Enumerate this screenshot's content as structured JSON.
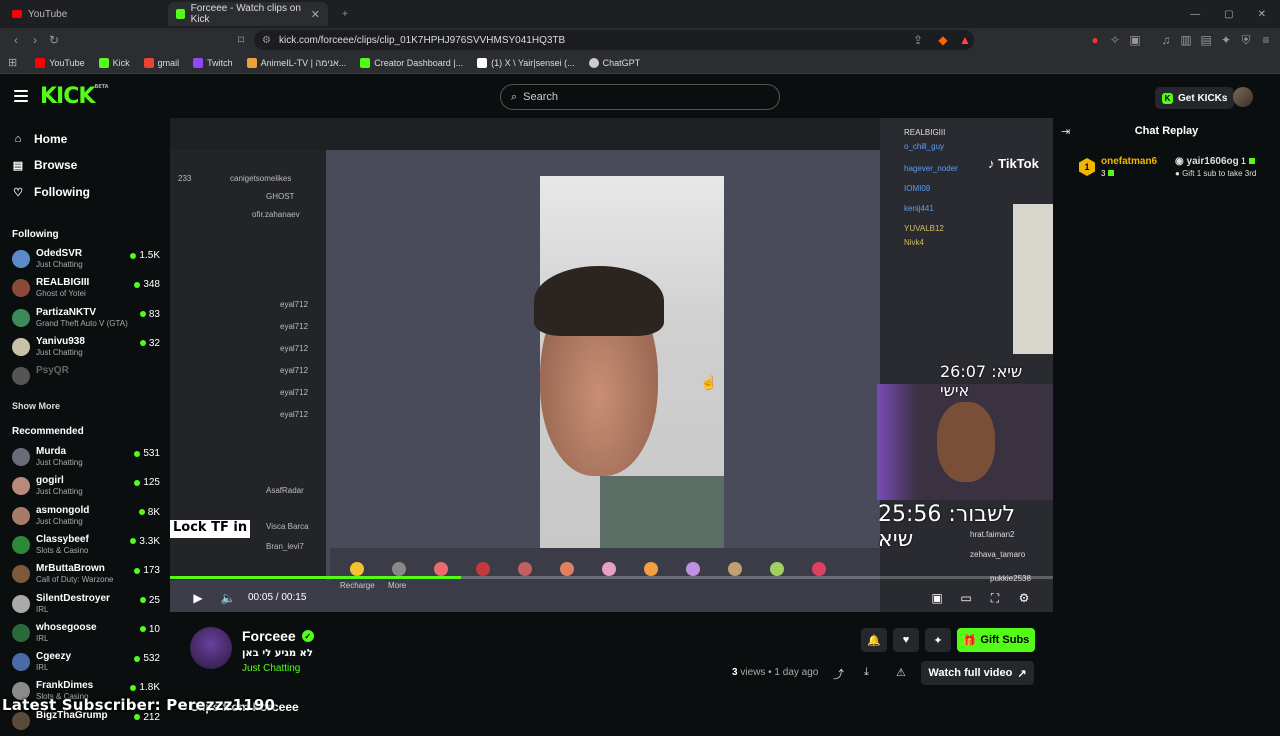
{
  "browser": {
    "tabs": [
      {
        "title": "YouTube"
      },
      {
        "title": "Forceee - Watch clips on Kick"
      }
    ],
    "url": "kick.com/forceee/clips/clip_01K7HPHJ976SVVHMSY041HQ3TB",
    "bookmarks": [
      {
        "label": "YouTube",
        "color": "#ff0000"
      },
      {
        "label": "Kick",
        "color": "#53fc18"
      },
      {
        "label": "gmail",
        "color": "#ea4335"
      },
      {
        "label": "Twitch",
        "color": "#9146ff"
      },
      {
        "label": "AnimeIL-TV | אנימה...",
        "color": "#e8a33b"
      },
      {
        "label": "Creator Dashboard |...",
        "color": "#53fc18"
      },
      {
        "label": "(1) X \\ Yair|sensei (...",
        "color": "#ffffff"
      },
      {
        "label": "ChatGPT",
        "color": "#cccccc"
      }
    ]
  },
  "header": {
    "logo": "KICK",
    "logo_badge": "BETA",
    "search_placeholder": "Search",
    "get_kicks": "Get KICKs"
  },
  "sidebar": {
    "nav": [
      {
        "label": "Home",
        "icon": "home-icon"
      },
      {
        "label": "Browse",
        "icon": "browse-icon"
      },
      {
        "label": "Following",
        "icon": "heart-icon"
      }
    ],
    "following_heading": "Following",
    "following": [
      {
        "name": "OdedSVR",
        "game": "Just Chatting",
        "viewers": "1.5K",
        "color": "#5b8ac9"
      },
      {
        "name": "REALBIGIII",
        "game": "Ghost of Yotei",
        "viewers": "348",
        "color": "#8a4a3a"
      },
      {
        "name": "PartizaNKTV",
        "game": "Grand Theft Auto V (GTA)",
        "viewers": "83",
        "color": "#3a8a5a"
      },
      {
        "name": "Yanivu938",
        "game": "Just Chatting",
        "viewers": "32",
        "color": "#c9c2a8"
      },
      {
        "name": "PsyQR",
        "game": "",
        "viewers": "",
        "color": "#555555"
      }
    ],
    "show_more": "Show More",
    "recommended_heading": "Recommended",
    "recommended": [
      {
        "name": "Murda",
        "game": "Just Chatting",
        "viewers": "531",
        "color": "#6a6a7a"
      },
      {
        "name": "gogirl",
        "game": "Just Chatting",
        "viewers": "125",
        "color": "#b88a7a"
      },
      {
        "name": "asmongold",
        "game": "Just Chatting",
        "viewers": "8K",
        "color": "#a87a6a"
      },
      {
        "name": "Classybeef",
        "game": "Slots & Casino",
        "viewers": "3.3K",
        "color": "#2a8a3a"
      },
      {
        "name": "MrButtaBrown",
        "game": "Call of Duty: Warzone",
        "viewers": "173",
        "color": "#7a5a3a"
      },
      {
        "name": "SilentDestroyer",
        "game": "IRL",
        "viewers": "25",
        "color": "#aaaaaa"
      },
      {
        "name": "whosegoose",
        "game": "IRL",
        "viewers": "10",
        "color": "#2a6a3a"
      },
      {
        "name": "Cgeezy",
        "game": "IRL",
        "viewers": "532",
        "color": "#4a6aaa"
      },
      {
        "name": "FrankDimes",
        "game": "Slots & Casino",
        "viewers": "1.8K",
        "color": "#8a8a8a"
      },
      {
        "name": "BigzThaGrump",
        "game": "",
        "viewers": "212",
        "color": "#5a4a3a"
      }
    ]
  },
  "video": {
    "overlay_tiktok": "TikTok",
    "overlay_timer1": "26:07 :שיא אישי",
    "overlay_timer2": "25:56 :לשבור שיא",
    "overlay_caption": "Lock TF in",
    "time_current": "00:05",
    "time_total": "00:15",
    "progress": 0.33,
    "gift_labels": [
      "Recharge",
      "More"
    ]
  },
  "chat": {
    "title": "Chat Replay",
    "pinned": {
      "rank": "1",
      "user": "onefatman6",
      "sub_count": "3",
      "gifter": "yair1606og",
      "gift_count": "1",
      "gift_text": "Gift 1 sub to take 3rd"
    }
  },
  "clip": {
    "streamer": "Forceee",
    "title": "לא מגיע לי באן",
    "category": "Just Chatting",
    "views": "3",
    "views_label": "views",
    "age": "• 1 day ago",
    "gift_subs": "Gift Subs",
    "watch_full": "Watch full video",
    "clips_from": "Clips from Forceee"
  },
  "stream_overlay": {
    "latest_subscriber": "Latest Subscriber: Perezzz1190"
  }
}
